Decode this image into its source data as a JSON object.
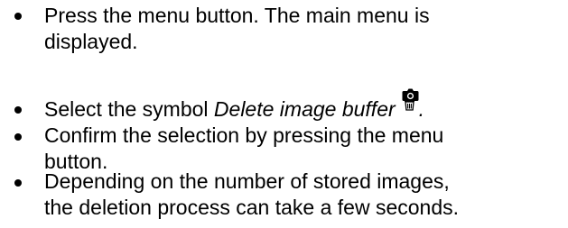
{
  "steps": [
    {
      "lines": [
        "Press the menu button. The main menu is",
        "displayed."
      ]
    },
    {
      "prefix": "Select the symbol ",
      "emphasis": "Delete image buffer",
      "suffix": ".",
      "icon": "camera-trash-icon"
    },
    {
      "lines": [
        "Confirm the selection by pressing the menu",
        "button."
      ]
    },
    {
      "lines": [
        "Depending on the number of stored images,",
        "the deletion process can take a few seconds."
      ]
    }
  ]
}
